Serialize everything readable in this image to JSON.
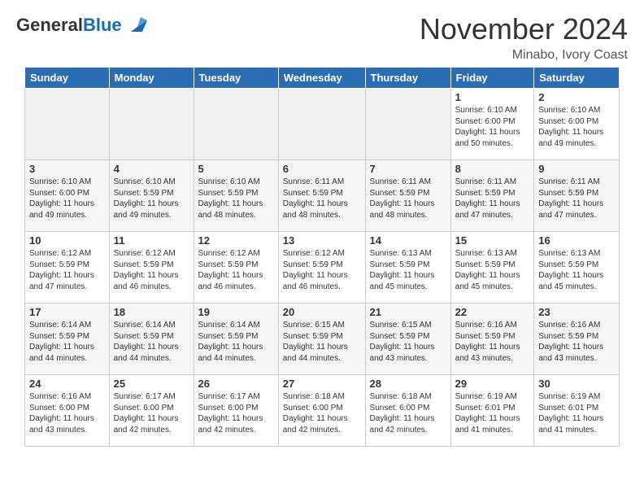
{
  "header": {
    "logo_general": "General",
    "logo_blue": "Blue",
    "month_title": "November 2024",
    "location": "Minabo, Ivory Coast"
  },
  "days_of_week": [
    "Sunday",
    "Monday",
    "Tuesday",
    "Wednesday",
    "Thursday",
    "Friday",
    "Saturday"
  ],
  "weeks": [
    [
      {
        "num": "",
        "empty": true
      },
      {
        "num": "",
        "empty": true
      },
      {
        "num": "",
        "empty": true
      },
      {
        "num": "",
        "empty": true
      },
      {
        "num": "",
        "empty": true
      },
      {
        "num": "1",
        "sunrise": "6:10 AM",
        "sunset": "6:00 PM",
        "daylight": "11 hours and 50 minutes."
      },
      {
        "num": "2",
        "sunrise": "6:10 AM",
        "sunset": "6:00 PM",
        "daylight": "11 hours and 49 minutes."
      }
    ],
    [
      {
        "num": "3",
        "sunrise": "6:10 AM",
        "sunset": "6:00 PM",
        "daylight": "11 hours and 49 minutes."
      },
      {
        "num": "4",
        "sunrise": "6:10 AM",
        "sunset": "5:59 PM",
        "daylight": "11 hours and 49 minutes."
      },
      {
        "num": "5",
        "sunrise": "6:10 AM",
        "sunset": "5:59 PM",
        "daylight": "11 hours and 48 minutes."
      },
      {
        "num": "6",
        "sunrise": "6:11 AM",
        "sunset": "5:59 PM",
        "daylight": "11 hours and 48 minutes."
      },
      {
        "num": "7",
        "sunrise": "6:11 AM",
        "sunset": "5:59 PM",
        "daylight": "11 hours and 48 minutes."
      },
      {
        "num": "8",
        "sunrise": "6:11 AM",
        "sunset": "5:59 PM",
        "daylight": "11 hours and 47 minutes."
      },
      {
        "num": "9",
        "sunrise": "6:11 AM",
        "sunset": "5:59 PM",
        "daylight": "11 hours and 47 minutes."
      }
    ],
    [
      {
        "num": "10",
        "sunrise": "6:12 AM",
        "sunset": "5:59 PM",
        "daylight": "11 hours and 47 minutes."
      },
      {
        "num": "11",
        "sunrise": "6:12 AM",
        "sunset": "5:59 PM",
        "daylight": "11 hours and 46 minutes."
      },
      {
        "num": "12",
        "sunrise": "6:12 AM",
        "sunset": "5:59 PM",
        "daylight": "11 hours and 46 minutes."
      },
      {
        "num": "13",
        "sunrise": "6:12 AM",
        "sunset": "5:59 PM",
        "daylight": "11 hours and 46 minutes."
      },
      {
        "num": "14",
        "sunrise": "6:13 AM",
        "sunset": "5:59 PM",
        "daylight": "11 hours and 45 minutes."
      },
      {
        "num": "15",
        "sunrise": "6:13 AM",
        "sunset": "5:59 PM",
        "daylight": "11 hours and 45 minutes."
      },
      {
        "num": "16",
        "sunrise": "6:13 AM",
        "sunset": "5:59 PM",
        "daylight": "11 hours and 45 minutes."
      }
    ],
    [
      {
        "num": "17",
        "sunrise": "6:14 AM",
        "sunset": "5:59 PM",
        "daylight": "11 hours and 44 minutes."
      },
      {
        "num": "18",
        "sunrise": "6:14 AM",
        "sunset": "5:59 PM",
        "daylight": "11 hours and 44 minutes."
      },
      {
        "num": "19",
        "sunrise": "6:14 AM",
        "sunset": "5:59 PM",
        "daylight": "11 hours and 44 minutes."
      },
      {
        "num": "20",
        "sunrise": "6:15 AM",
        "sunset": "5:59 PM",
        "daylight": "11 hours and 44 minutes."
      },
      {
        "num": "21",
        "sunrise": "6:15 AM",
        "sunset": "5:59 PM",
        "daylight": "11 hours and 43 minutes."
      },
      {
        "num": "22",
        "sunrise": "6:16 AM",
        "sunset": "5:59 PM",
        "daylight": "11 hours and 43 minutes."
      },
      {
        "num": "23",
        "sunrise": "6:16 AM",
        "sunset": "5:59 PM",
        "daylight": "11 hours and 43 minutes."
      }
    ],
    [
      {
        "num": "24",
        "sunrise": "6:16 AM",
        "sunset": "6:00 PM",
        "daylight": "11 hours and 43 minutes."
      },
      {
        "num": "25",
        "sunrise": "6:17 AM",
        "sunset": "6:00 PM",
        "daylight": "11 hours and 42 minutes."
      },
      {
        "num": "26",
        "sunrise": "6:17 AM",
        "sunset": "6:00 PM",
        "daylight": "11 hours and 42 minutes."
      },
      {
        "num": "27",
        "sunrise": "6:18 AM",
        "sunset": "6:00 PM",
        "daylight": "11 hours and 42 minutes."
      },
      {
        "num": "28",
        "sunrise": "6:18 AM",
        "sunset": "6:00 PM",
        "daylight": "11 hours and 42 minutes."
      },
      {
        "num": "29",
        "sunrise": "6:19 AM",
        "sunset": "6:01 PM",
        "daylight": "11 hours and 41 minutes."
      },
      {
        "num": "30",
        "sunrise": "6:19 AM",
        "sunset": "6:01 PM",
        "daylight": "11 hours and 41 minutes."
      }
    ]
  ]
}
